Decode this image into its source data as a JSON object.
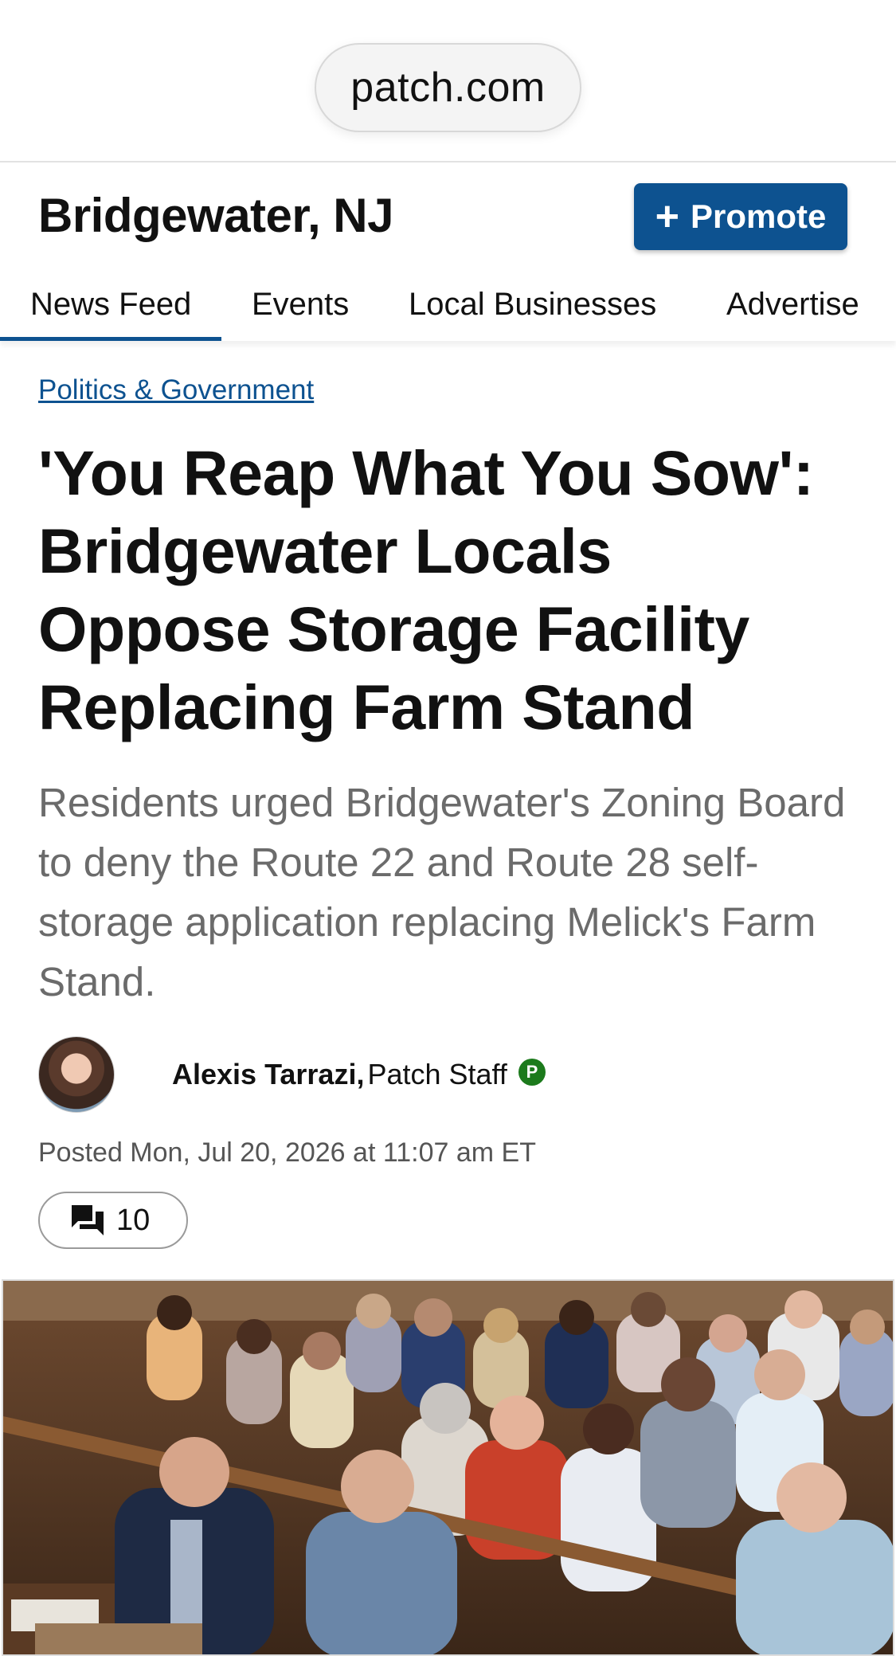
{
  "browser": {
    "url": "patch.com"
  },
  "header": {
    "site_title": "Bridgewater, NJ",
    "promote_label": "Promote",
    "promote_color": "#0d5290"
  },
  "nav": {
    "tabs": [
      {
        "label": "News Feed",
        "active": true
      },
      {
        "label": "Events",
        "active": false
      },
      {
        "label": "Local Businesses",
        "active": false
      },
      {
        "label": "Advertise",
        "active": false
      }
    ]
  },
  "article": {
    "category": "Politics & Government",
    "headline": "'You Reap What You Sow': Bridgewater Locals Oppose Storage Facility Replacing Farm Stand",
    "dek": "Residents urged Bridgewater's Zoning Board to deny the Route 22 and Route 28 self-storage application replacing Melick's Farm Stand.",
    "author": "Alexis Tarrazi,",
    "author_role": "Patch Staff",
    "badge_letter": "P",
    "posted": "Posted Mon, Jul 20, 2026 at 11:07 am ET",
    "comment_count": "10"
  },
  "icons": {
    "promote": "plus-icon",
    "comments": "comment-bubbles-icon",
    "badge": "patch-p-badge-icon"
  }
}
